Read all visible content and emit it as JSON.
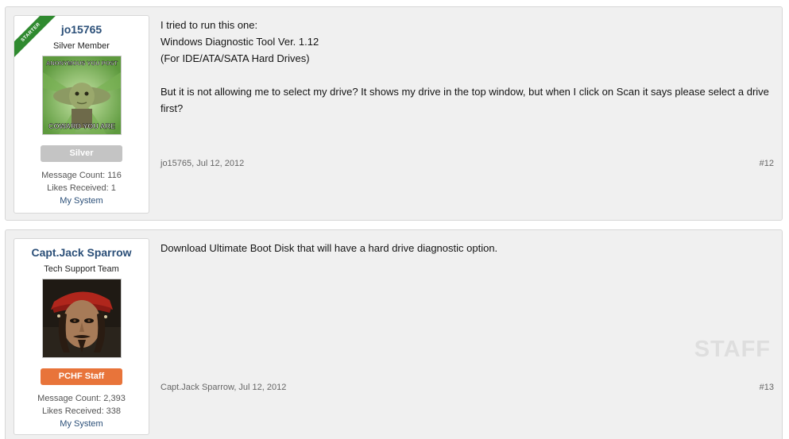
{
  "posts": [
    {
      "ribbon": "STARTER",
      "username": "jo15765",
      "usertitle": "Silver Member",
      "avatar_top_text": "ANONYMOUS YOU POST",
      "avatar_bottom_text": "COWARD YOU ARE",
      "banner": "Silver",
      "message_count": "Message Count: 116",
      "likes_received": "Likes Received: 1",
      "my_system": "My System",
      "lines": [
        "I tried to run this one:",
        "Windows Diagnostic Tool Ver. 1.12",
        "(For IDE/ATA/SATA Hard Drives)",
        "But it is not allowing me to select my drive? It shows my drive in the top window, but when I click on Scan it says please select a drive first?"
      ],
      "meta": "jo15765, Jul 12, 2012",
      "number": "#12"
    },
    {
      "username": "Capt.Jack Sparrow",
      "usertitle": "Tech Support Team",
      "banner": "PCHF Staff",
      "message_count": "Message Count: 2,393",
      "likes_received": "Likes Received: 338",
      "my_system": "My System",
      "lines": [
        "Download Ultimate Boot Disk that will have a hard drive diagnostic option."
      ],
      "staff_mark": "STAFF",
      "meta": "Capt.Jack Sparrow, Jul 12, 2012",
      "number": "#13"
    }
  ],
  "colors": {
    "username": "#2b4f78",
    "silver_banner": "#c4c4c4",
    "staff_banner": "#e8743a",
    "starter_ribbon": "#2f8a2f"
  }
}
